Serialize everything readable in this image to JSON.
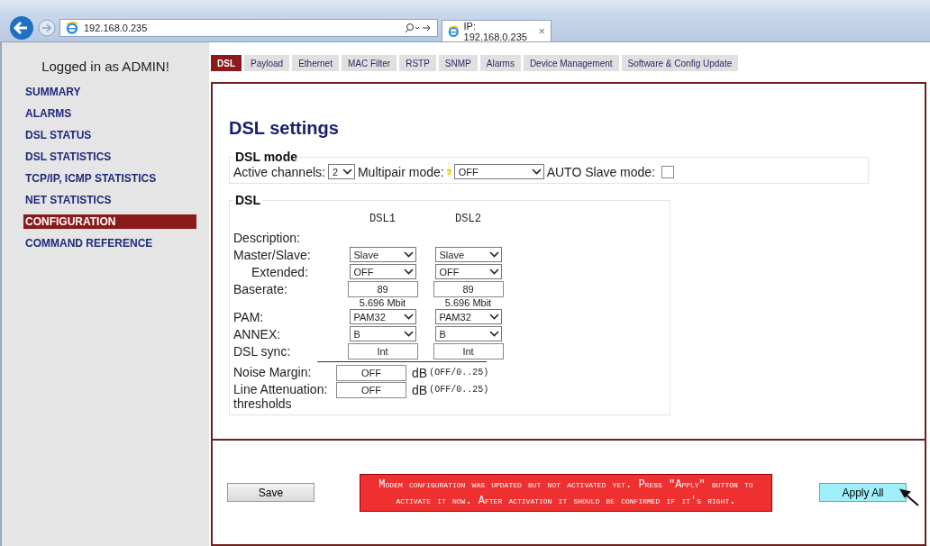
{
  "browser": {
    "address": "192.168.0.235",
    "tab_title": "IP: 192.168.0.235",
    "tab_close": "×"
  },
  "sidebar": {
    "login": "Logged in as ADMIN!",
    "items": [
      {
        "label": "SUMMARY",
        "selected": false
      },
      {
        "label": "ALARMS",
        "selected": false
      },
      {
        "label": "DSL STATUS",
        "selected": false
      },
      {
        "label": "DSL STATISTICS",
        "selected": false
      },
      {
        "label": "TCP/IP, ICMP STATISTICS",
        "selected": false
      },
      {
        "label": "NET STATISTICS",
        "selected": false
      },
      {
        "label": "CONFIGURATION",
        "selected": true
      },
      {
        "label": "COMMAND REFERENCE",
        "selected": false
      }
    ]
  },
  "tabs": [
    {
      "label": "DSL",
      "selected": true
    },
    {
      "label": "Payload",
      "selected": false
    },
    {
      "label": "Ethernet",
      "selected": false
    },
    {
      "label": "MAC Filter",
      "selected": false
    },
    {
      "label": "RSTP",
      "selected": false
    },
    {
      "label": "SNMP",
      "selected": false
    },
    {
      "label": "Alarms",
      "selected": false
    },
    {
      "label": "Device Management",
      "selected": false
    },
    {
      "label": "Software & Config Update",
      "selected": false
    }
  ],
  "page_title": "DSL settings",
  "dsl_mode": {
    "legend": "DSL mode",
    "active_channels": {
      "label": "Active channels:",
      "value": "2"
    },
    "multipair": {
      "label": "Multipair mode:",
      "help": "?",
      "value": "OFF"
    },
    "auto_slave": {
      "label": "AUTO Slave mode:",
      "checked": false
    }
  },
  "dsl": {
    "legend": "DSL",
    "channels": [
      "DSL1",
      "DSL2"
    ],
    "rows": [
      {
        "kind": "label",
        "label": "Description:"
      },
      {
        "kind": "select",
        "label": "Master/Slave:",
        "values": [
          "Slave",
          "Slave"
        ]
      },
      {
        "kind": "subselect",
        "label": "Extended:",
        "values": [
          "OFF",
          "OFF"
        ]
      },
      {
        "kind": "input",
        "label": "Baserate:",
        "values": [
          "89",
          "89"
        ],
        "notes": [
          "5.696 Mbit",
          "5.696 Mbit"
        ]
      },
      {
        "kind": "select",
        "label": "PAM:",
        "values": [
          "PAM32",
          "PAM32"
        ]
      },
      {
        "kind": "select",
        "label": "ANNEX:",
        "values": [
          "B",
          "B"
        ]
      },
      {
        "kind": "input",
        "label": "DSL sync:",
        "values": [
          "Int",
          "Int"
        ]
      },
      {
        "kind": "threshold",
        "label": "Noise Margin:",
        "value": "OFF",
        "unit": "dB",
        "range": "(OFF/0..25)"
      },
      {
        "kind": "threshold",
        "label": "Line Attenuation: thresholds",
        "value": "OFF",
        "unit": "dB",
        "range": "(OFF/0..25)"
      }
    ]
  },
  "footer": {
    "save": "Save",
    "message": "Modem configuration was updated but not activated yet. Press \"Apply\" button to activate it now. After activation it should be confirmed if it's right.",
    "apply": "Apply All"
  }
}
